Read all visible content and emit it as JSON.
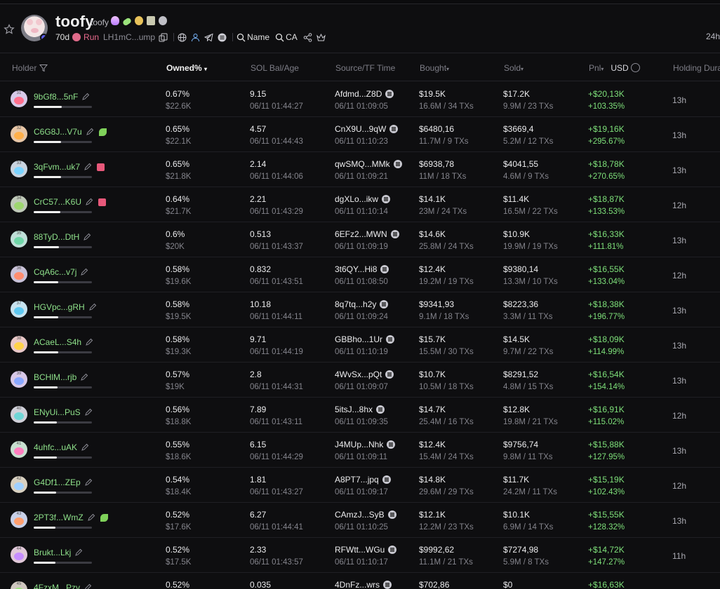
{
  "token": {
    "name": "toofy",
    "symbol": "toofy",
    "age": "70d",
    "launchpad": "Run",
    "contract": "LH1mC...ump",
    "search_name": "Name",
    "search_ca": "CA",
    "timeframe": "24h"
  },
  "columns": {
    "holder": "Holder",
    "owned": "Owned%",
    "sol_bal": "SOL Bal/Age",
    "source": "Source/TF Time",
    "bought": "Bought",
    "sold": "Sold",
    "pnl": "Pnl",
    "usd": "USD",
    "holding": "Holding Dura"
  },
  "colors": {
    "holder_green": "#8ee08a",
    "pnl_green": "#7ee07a",
    "launch_pink": "#e86a8d",
    "background": "#0e0e10"
  },
  "holders": [
    {
      "num": "31",
      "addr": "9bGf8...5nF",
      "extra": "",
      "owned_pct": 0.67,
      "owned": "0.67%",
      "owned_usd": "$22.6K",
      "sol": "9.15",
      "sol_time": "06/11 01:44:27",
      "source": "Afdmd...Z8D",
      "source_time": "06/11 01:09:05",
      "bought": "$19.5K",
      "bought_sub": "16.6M / 34 TXs",
      "sold": "$17.2K",
      "sold_sub": "9.9M / 23 TXs",
      "pnl": "+$20,13K",
      "pnl_pct": "+103.35%",
      "hold": "13h"
    },
    {
      "num": "32",
      "addr": "C6G8J...V7u",
      "extra": "leaf",
      "owned_pct": 0.65,
      "owned": "0.65%",
      "owned_usd": "$22.1K",
      "sol": "4.57",
      "sol_time": "06/11 01:44:43",
      "source": "CnX9U...9qW",
      "source_time": "06/11 01:10:23",
      "bought": "$6480,16",
      "bought_sub": "11.7M / 9 TXs",
      "sold": "$3669,4",
      "sold_sub": "5.2M / 12 TXs",
      "pnl": "+$19,16K",
      "pnl_pct": "+295.67%",
      "hold": "13h"
    },
    {
      "num": "33",
      "addr": "3qFvm...uk7",
      "extra": "stack",
      "owned_pct": 0.65,
      "owned": "0.65%",
      "owned_usd": "$21.8K",
      "sol": "2.14",
      "sol_time": "06/11 01:44:06",
      "source": "qwSMQ...MMk",
      "source_time": "06/11 01:09:21",
      "bought": "$6938,78",
      "bought_sub": "11M / 18 TXs",
      "sold": "$4041,55",
      "sold_sub": "4.6M / 9 TXs",
      "pnl": "+$18,78K",
      "pnl_pct": "+270.65%",
      "hold": "13h"
    },
    {
      "num": "34",
      "addr": "CrC57...K6U",
      "extra": "stack",
      "owned_pct": 0.64,
      "owned": "0.64%",
      "owned_usd": "$21.7K",
      "sol": "2.21",
      "sol_time": "06/11 01:43:29",
      "source": "dgXLo...ikw",
      "source_time": "06/11 01:10:14",
      "bought": "$14.1K",
      "bought_sub": "23M / 24 TXs",
      "sold": "$11.4K",
      "sold_sub": "16.5M / 22 TXs",
      "pnl": "+$18,87K",
      "pnl_pct": "+133.53%",
      "hold": "12h"
    },
    {
      "num": "35",
      "addr": "88TyD...DtH",
      "extra": "",
      "owned_pct": 0.6,
      "owned": "0.6%",
      "owned_usd": "$20K",
      "sol": "0.513",
      "sol_time": "06/11 01:43:37",
      "source": "6EFz2...MWN",
      "source_time": "06/11 01:09:19",
      "bought": "$14.6K",
      "bought_sub": "25.8M / 24 TXs",
      "sold": "$10.9K",
      "sold_sub": "19.9M / 19 TXs",
      "pnl": "+$16,33K",
      "pnl_pct": "+111.81%",
      "hold": "13h"
    },
    {
      "num": "36",
      "addr": "CqA6c...v7j",
      "extra": "",
      "owned_pct": 0.58,
      "owned": "0.58%",
      "owned_usd": "$19.6K",
      "sol": "0.832",
      "sol_time": "06/11 01:43:51",
      "source": "3t6QY...Hi8",
      "source_time": "06/11 01:08:50",
      "bought": "$12.4K",
      "bought_sub": "19.2M / 19 TXs",
      "sold": "$9380,14",
      "sold_sub": "13.3M / 10 TXs",
      "pnl": "+$16,55K",
      "pnl_pct": "+133.04%",
      "hold": "12h"
    },
    {
      "num": "37",
      "addr": "HGVpc...gRH",
      "extra": "",
      "owned_pct": 0.58,
      "owned": "0.58%",
      "owned_usd": "$19.5K",
      "sol": "10.18",
      "sol_time": "06/11 01:44:11",
      "source": "8q7tq...h2y",
      "source_time": "06/11 01:09:24",
      "bought": "$9341,93",
      "bought_sub": "9.1M / 18 TXs",
      "sold": "$8223,36",
      "sold_sub": "3.3M / 11 TXs",
      "pnl": "+$18,38K",
      "pnl_pct": "+196.77%",
      "hold": "13h"
    },
    {
      "num": "38",
      "addr": "ACaeL...S4h",
      "extra": "",
      "owned_pct": 0.58,
      "owned": "0.58%",
      "owned_usd": "$19.3K",
      "sol": "9.71",
      "sol_time": "06/11 01:44:19",
      "source": "GBBho...1Ur",
      "source_time": "06/11 01:10:19",
      "bought": "$15.7K",
      "bought_sub": "15.5M / 30 TXs",
      "sold": "$14.5K",
      "sold_sub": "9.7M / 22 TXs",
      "pnl": "+$18,09K",
      "pnl_pct": "+114.99%",
      "hold": "13h"
    },
    {
      "num": "39",
      "addr": "BCHlM...rjb",
      "extra": "",
      "owned_pct": 0.57,
      "owned": "0.57%",
      "owned_usd": "$19K",
      "sol": "2.8",
      "sol_time": "06/11 01:44:31",
      "source": "4WvSx...pQt",
      "source_time": "06/11 01:09:07",
      "bought": "$10.7K",
      "bought_sub": "10.5M / 18 TXs",
      "sold": "$8291,52",
      "sold_sub": "4.8M / 15 TXs",
      "pnl": "+$16,54K",
      "pnl_pct": "+154.14%",
      "hold": "13h"
    },
    {
      "num": "40",
      "addr": "ENyUi...PuS",
      "extra": "",
      "owned_pct": 0.56,
      "owned": "0.56%",
      "owned_usd": "$18.8K",
      "sol": "7.89",
      "sol_time": "06/11 01:43:11",
      "source": "5itsJ...8hx",
      "source_time": "06/11 01:09:35",
      "bought": "$14.7K",
      "bought_sub": "25.4M / 16 TXs",
      "sold": "$12.8K",
      "sold_sub": "19.8M / 21 TXs",
      "pnl": "+$16,91K",
      "pnl_pct": "+115.02%",
      "hold": "12h"
    },
    {
      "num": "41",
      "addr": "4uhfc...uAK",
      "extra": "",
      "owned_pct": 0.55,
      "owned": "0.55%",
      "owned_usd": "$18.6K",
      "sol": "6.15",
      "sol_time": "06/11 01:44:29",
      "source": "J4MUp...Nhk",
      "source_time": "06/11 01:09:11",
      "bought": "$12.4K",
      "bought_sub": "15.4M / 24 TXs",
      "sold": "$9756,74",
      "sold_sub": "9.8M / 11 TXs",
      "pnl": "+$15,88K",
      "pnl_pct": "+127.95%",
      "hold": "13h"
    },
    {
      "num": "42",
      "addr": "G4Df1...ZEp",
      "extra": "",
      "owned_pct": 0.54,
      "owned": "0.54%",
      "owned_usd": "$18.4K",
      "sol": "1.81",
      "sol_time": "06/11 01:43:27",
      "source": "A8PT7...jpq",
      "source_time": "06/11 01:09:17",
      "bought": "$14.8K",
      "bought_sub": "29.6M / 29 TXs",
      "sold": "$11.7K",
      "sold_sub": "24.2M / 11 TXs",
      "pnl": "+$15,19K",
      "pnl_pct": "+102.43%",
      "hold": "12h"
    },
    {
      "num": "43",
      "addr": "2PT3f...WmZ",
      "extra": "leaf",
      "owned_pct": 0.52,
      "owned": "0.52%",
      "owned_usd": "$17.6K",
      "sol": "6.27",
      "sol_time": "06/11 01:44:41",
      "source": "CAmzJ...SyB",
      "source_time": "06/11 01:10:25",
      "bought": "$12.1K",
      "bought_sub": "12.2M / 23 TXs",
      "sold": "$10.1K",
      "sold_sub": "6.9M / 14 TXs",
      "pnl": "+$15,55K",
      "pnl_pct": "+128.32%",
      "hold": "13h"
    },
    {
      "num": "44",
      "addr": "Brukt...Lkj",
      "extra": "",
      "owned_pct": 0.52,
      "owned": "0.52%",
      "owned_usd": "$17.5K",
      "sol": "2.33",
      "sol_time": "06/11 01:43:57",
      "source": "RFWtt...WGu",
      "source_time": "06/11 01:10:17",
      "bought": "$9992,62",
      "bought_sub": "11.1M / 21 TXs",
      "sold": "$7274,98",
      "sold_sub": "5.9M / 8 TXs",
      "pnl": "+$14,72K",
      "pnl_pct": "+147.27%",
      "hold": "11h"
    },
    {
      "num": "45",
      "addr": "4FzxM...Pzv",
      "extra": "",
      "owned_pct": 0.52,
      "owned": "0.52%",
      "owned_usd": "",
      "sol": "0.035",
      "sol_time": "",
      "source": "4DnFz...wrs",
      "source_time": "",
      "bought": "$702,86",
      "bought_sub": "",
      "sold": "$0",
      "sold_sub": "",
      "pnl": "+$16,63K",
      "pnl_pct": "",
      "hold": ""
    }
  ]
}
